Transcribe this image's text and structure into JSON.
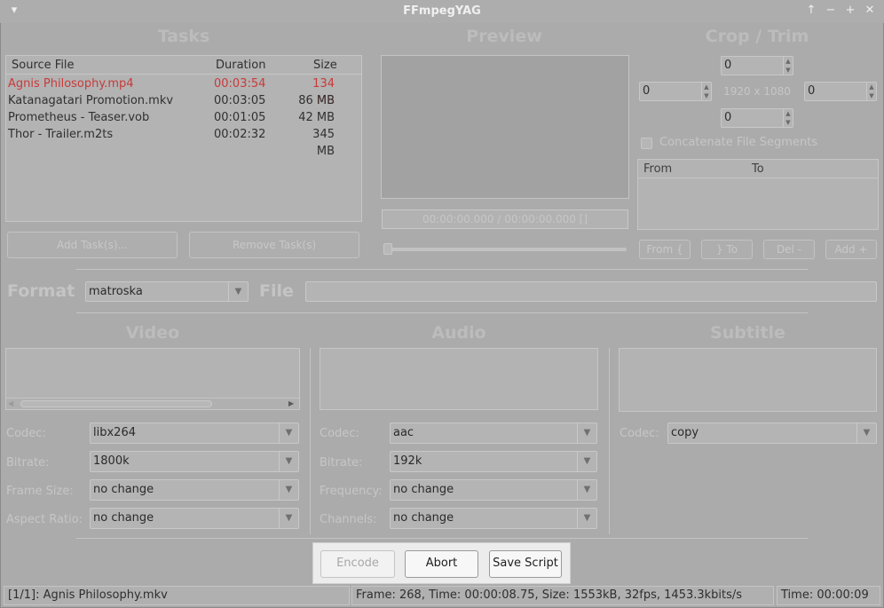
{
  "window": {
    "title": "FFmpegYAG"
  },
  "tasks": {
    "heading": "Tasks",
    "columns": [
      "Source File",
      "Duration",
      "Size"
    ],
    "rows": [
      {
        "file": "Agnis Philosophy.mp4",
        "duration": "00:03:54",
        "size": "134 MB",
        "selected": true
      },
      {
        "file": "Katanagatari Promotion.mkv",
        "duration": "00:03:05",
        "size": "86 MB"
      },
      {
        "file": "Prometheus - Teaser.vob",
        "duration": "00:01:05",
        "size": "42 MB"
      },
      {
        "file": "Thor - Trailer.m2ts",
        "duration": "00:02:32",
        "size": "345 MB"
      }
    ],
    "add_button": "Add Task(s)...",
    "remove_button": "Remove Task(s)"
  },
  "preview": {
    "heading": "Preview",
    "time": "00:00:00.000 / 00:00:00.000 []"
  },
  "crop": {
    "heading": "Crop / Trim",
    "top": "0",
    "left": "0",
    "right": "0",
    "bottom": "0",
    "resolution": "1920 x 1080",
    "concat_label": "Concatenate File Segments",
    "columns": [
      "From",
      "To"
    ],
    "buttons": {
      "from": "From {",
      "to": "} To",
      "del": "Del -",
      "add": "Add +"
    }
  },
  "format": {
    "label": "Format",
    "value": "matroska",
    "file_label": "File",
    "file_value": ""
  },
  "video": {
    "heading": "Video",
    "codec_label": "Codec:",
    "codec": "libx264",
    "bitrate_label": "Bitrate:",
    "bitrate": "1800k",
    "framesize_label": "Frame Size:",
    "framesize": "no change",
    "aspect_label": "Aspect Ratio:",
    "aspect": "no change"
  },
  "audio": {
    "heading": "Audio",
    "codec_label": "Codec:",
    "codec": "aac",
    "bitrate_label": "Bitrate:",
    "bitrate": "192k",
    "freq_label": "Frequency:",
    "freq": "no change",
    "channels_label": "Channels:",
    "channels": "no change"
  },
  "subtitle": {
    "heading": "Subtitle",
    "codec_label": "Codec:",
    "codec": "copy"
  },
  "actions": {
    "encode": "Encode",
    "abort": "Abort",
    "save": "Save Script"
  },
  "status": {
    "task": "[1/1]: Agnis Philosophy.mkv",
    "progress": "Frame: 268, Time: 00:00:08.75, Size: 1553kB, 32fps, 1453.3kbits/s",
    "time": "Time: 00:00:09"
  },
  "colors": {
    "selected_row": "#c93a3a",
    "overlay_bg": "#ababab"
  }
}
